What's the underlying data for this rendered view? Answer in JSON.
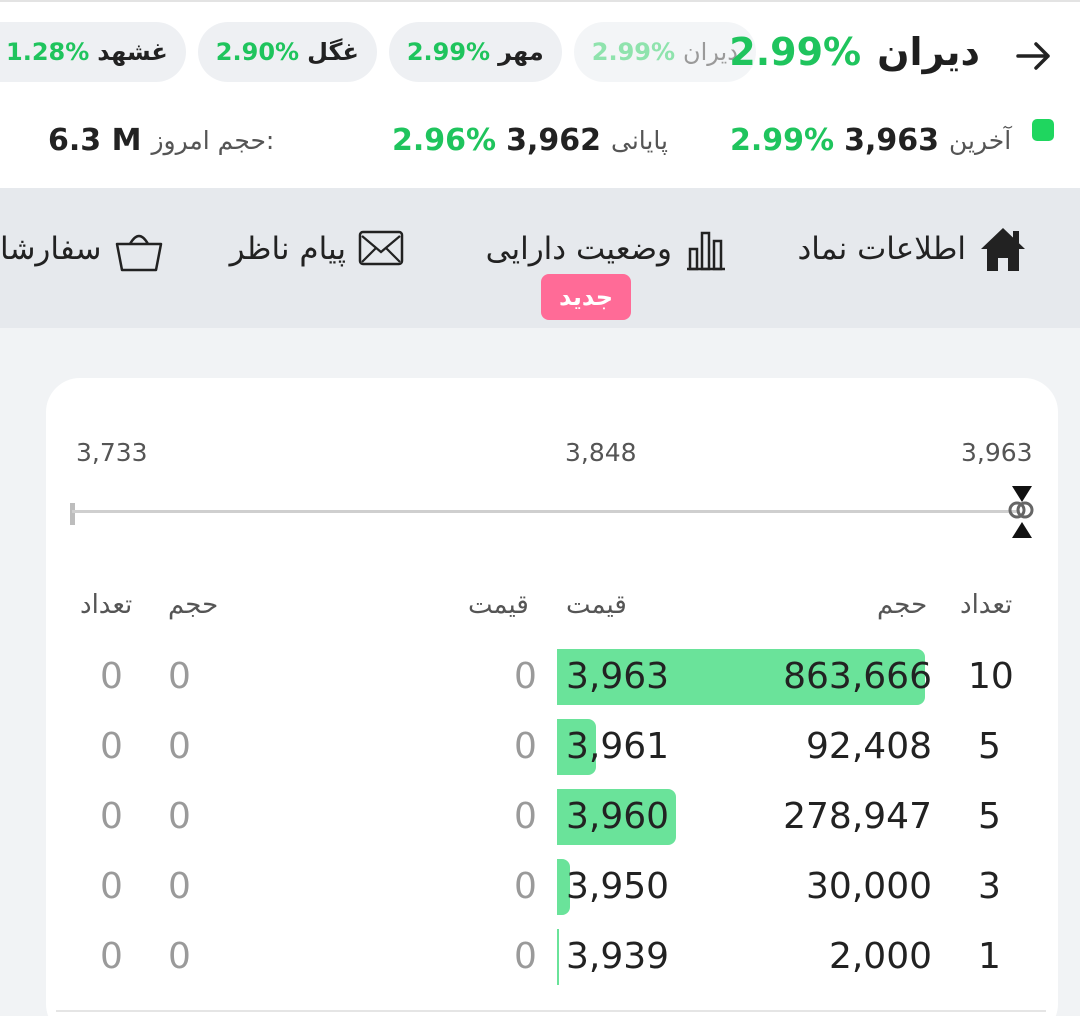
{
  "header": {
    "symbol_name": "دیران",
    "symbol_change": "2.99%",
    "chips": [
      {
        "name": "غشهد",
        "change": "1.28%"
      },
      {
        "name": "غگل",
        "change": "2.90%"
      },
      {
        "name": "مهر",
        "change": "2.99%"
      },
      {
        "name": "دیران",
        "change": "2.99%"
      }
    ],
    "stats": {
      "last_label": "آخرین",
      "last_value": "3,963",
      "last_change": "2.99%",
      "close_label": "پایانی",
      "close_value": "3,962",
      "close_change": "2.96%",
      "volume_label": "حجم امروز:",
      "volume_value": "6.3 M"
    }
  },
  "tabs": [
    {
      "label": "اطلاعات نماد",
      "icon": "home-icon"
    },
    {
      "label": "وضعیت دارایی",
      "icon": "bar-chart-icon",
      "badge": "جدید"
    },
    {
      "label": "پیام ناظر",
      "icon": "envelope-icon"
    },
    {
      "label": "سفارشا",
      "icon": "basket-icon"
    }
  ],
  "range": {
    "low": "3,733",
    "mid": "3,848",
    "high": "3,963"
  },
  "orderbook": {
    "headers": {
      "buy_count": "تعداد",
      "buy_volume": "حجم",
      "buy_price": "قیمت",
      "sell_price": "قیمت",
      "sell_volume": "حجم",
      "sell_count": "تعداد"
    },
    "rows": [
      {
        "buy_count": "10",
        "buy_volume": "863,666",
        "buy_price": "3,963",
        "buy_volume_share": 1.0,
        "sell_price": "0",
        "sell_volume": "0",
        "sell_count": "0"
      },
      {
        "buy_count": "5",
        "buy_volume": "92,408",
        "buy_price": "3,961",
        "buy_volume_share": 0.107,
        "sell_price": "0",
        "sell_volume": "0",
        "sell_count": "0"
      },
      {
        "buy_count": "5",
        "buy_volume": "278,947",
        "buy_price": "3,960",
        "buy_volume_share": 0.323,
        "sell_price": "0",
        "sell_volume": "0",
        "sell_count": "0"
      },
      {
        "buy_count": "3",
        "buy_volume": "30,000",
        "buy_price": "3,950",
        "buy_volume_share": 0.035,
        "sell_price": "0",
        "sell_volume": "0",
        "sell_count": "0"
      },
      {
        "buy_count": "1",
        "buy_volume": "2,000",
        "buy_price": "3,939",
        "buy_volume_share": 0.002,
        "sell_price": "0",
        "sell_volume": "0",
        "sell_count": "0"
      }
    ]
  },
  "colors": {
    "positive": "#1fc45d",
    "buy_bar": "#6ae39a",
    "badge": "#ff6b97",
    "live_dot": "#1fd65f"
  }
}
